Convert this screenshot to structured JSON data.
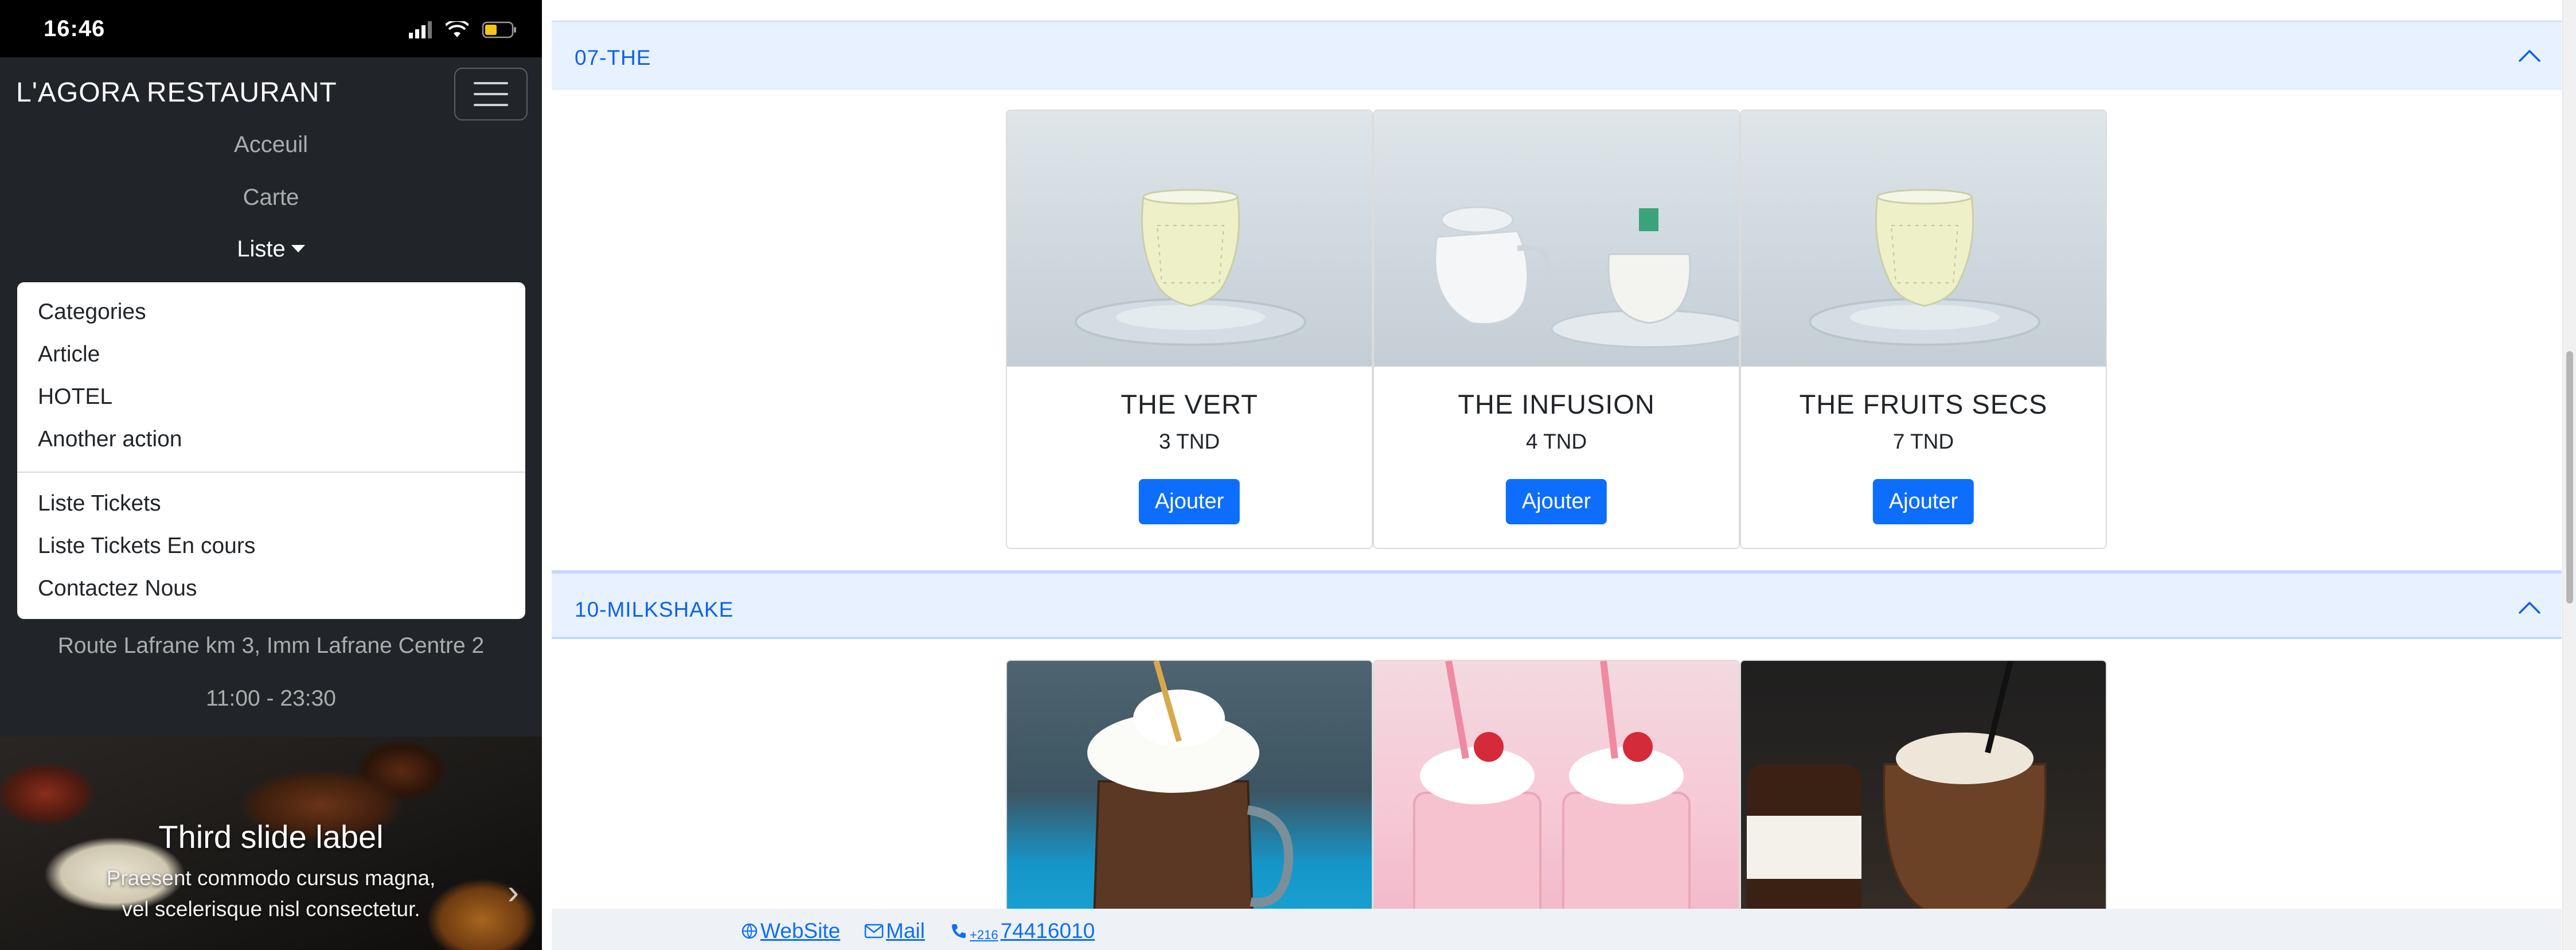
{
  "status_bar": {
    "time": "16:46"
  },
  "navbar": {
    "brand": "L'AGORA RESTAURANT",
    "links": {
      "accueil": "Acceuil",
      "carte": "Carte",
      "liste": "Liste"
    },
    "dropdown": {
      "items_top": [
        "Categories",
        "Article",
        "HOTEL",
        "Another action"
      ],
      "items_bottom": [
        "Liste Tickets",
        "Liste Tickets En cours",
        "Contactez Nous"
      ]
    },
    "address": "Route Lafrane km 3, Imm Lafrane Centre 2",
    "hours": "11:00 - 23:30"
  },
  "carousel": {
    "label": "Third slide label",
    "text_line1": "Praesent commodo cursus magna,",
    "text_line2": "vel scelerisque nisl consectetur."
  },
  "sections": [
    {
      "title": "07-THE",
      "items": [
        {
          "name": "THE VERT",
          "price": "3 TND",
          "button": "Ajouter"
        },
        {
          "name": "THE INFUSION",
          "price": "4 TND",
          "button": "Ajouter"
        },
        {
          "name": "THE FRUITS SECS",
          "price": "7 TND",
          "button": "Ajouter"
        }
      ]
    },
    {
      "title": "10-MILKSHAKE",
      "items": [
        {
          "name": "",
          "price": "",
          "button": ""
        },
        {
          "name": "",
          "price": "",
          "button": ""
        },
        {
          "name": "",
          "price": "",
          "button": ""
        }
      ]
    }
  ],
  "footer": {
    "website": "WebSite",
    "mail": "Mail",
    "phone_prefix": "+216",
    "phone": "74416010"
  },
  "colors": {
    "accent": "#0d6efd",
    "accordion_bg": "#e7f1ff",
    "accordion_text": "#0c63e4",
    "navbar_bg": "#212529"
  }
}
